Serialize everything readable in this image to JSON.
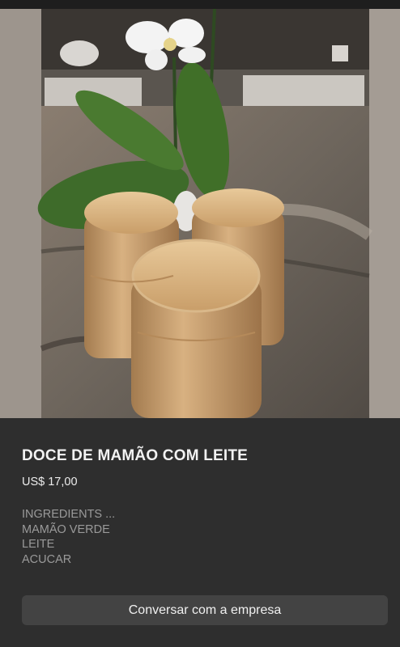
{
  "product": {
    "title": "DOCE DE MAMÃO COM LEITE",
    "price": "US$ 17,00",
    "description_lines": [
      "INGREDIENTS ...",
      "MAMÃO VERDE",
      "LEITE",
      "ACUCAR"
    ]
  },
  "actions": {
    "chat_label": "Conversar com a empresa"
  }
}
